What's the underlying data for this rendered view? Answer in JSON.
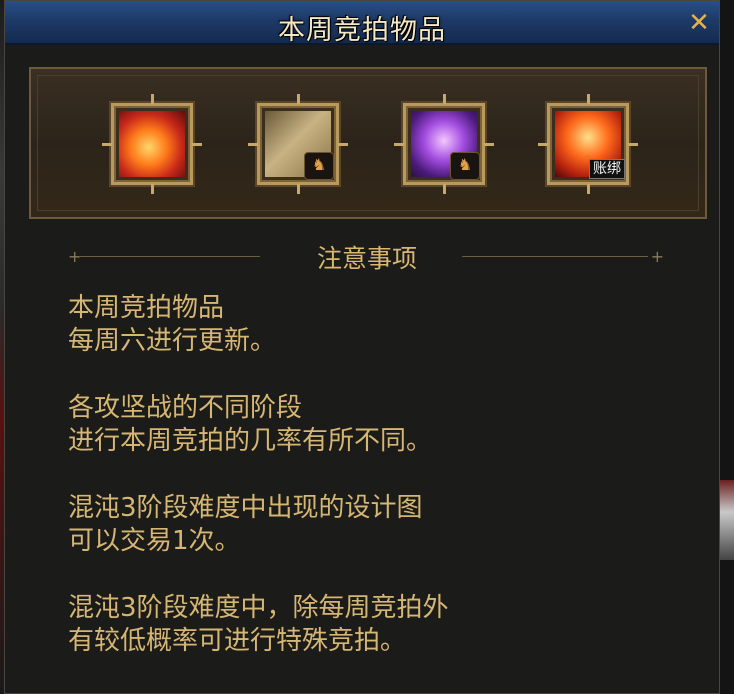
{
  "window": {
    "title": "本周竞拍物品",
    "close_glyph": "✕"
  },
  "items": [
    {
      "icon": "flame-orb-icon",
      "emblem": ""
    },
    {
      "icon": "gold-scroll-icon",
      "emblem": "♞"
    },
    {
      "icon": "purple-orb-icon",
      "emblem": "♞"
    },
    {
      "icon": "fire-material-icon",
      "tag": "账绑"
    }
  ],
  "notice": {
    "heading": "注意事项",
    "paragraphs": [
      [
        "本周竞拍物品",
        "每周六进行更新。"
      ],
      [
        "各攻坚战的不同阶段",
        "进行本周竞拍的几率有所不同。"
      ],
      [
        "混沌3阶段难度中出现的设计图",
        "可以交易1次。"
      ],
      [
        "混沌3阶段难度中，除每周竞拍外",
        "有较低概率可进行特殊竞拍。"
      ]
    ]
  }
}
